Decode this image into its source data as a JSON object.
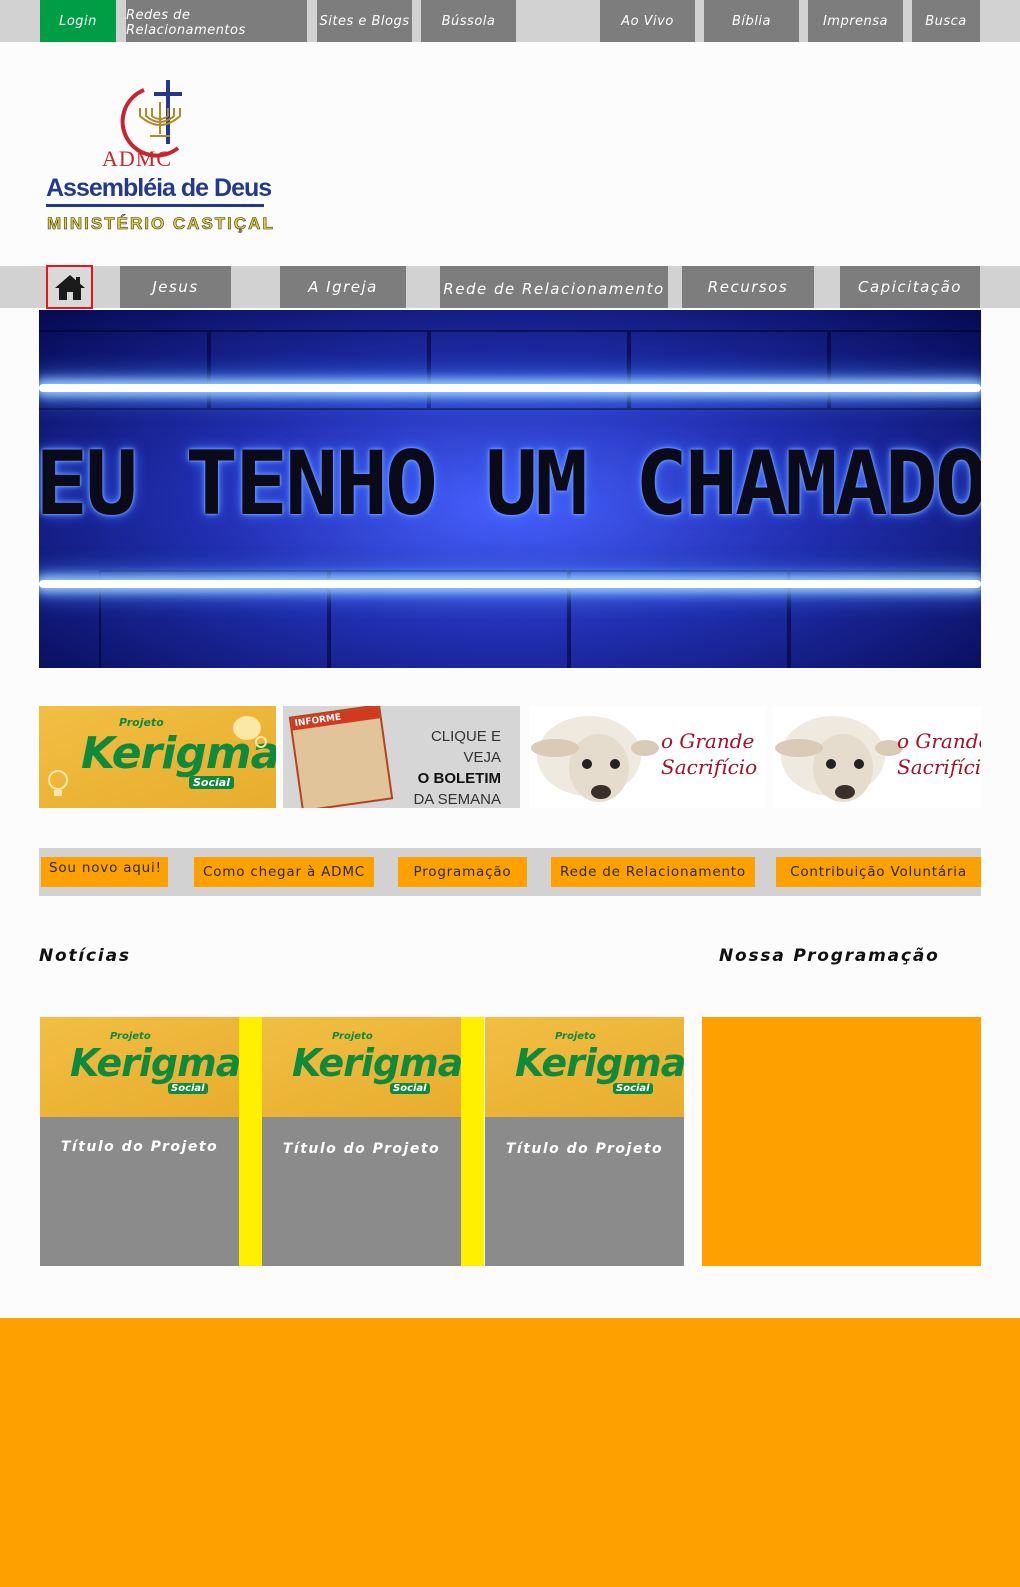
{
  "top_menu": {
    "login": "Login",
    "redes": "Redes de Relacionamentos",
    "sites": "Sites e Blogs",
    "bussola": "Bússola",
    "ao_vivo": "Ao Vivo",
    "biblia": "Bíblia",
    "imprensa": "Imprensa",
    "busca": "Busca"
  },
  "logo": {
    "acronym": "ADMC",
    "name": "Assembléia de Deus",
    "ministry": "MINISTÉRIO CASTIÇAL"
  },
  "main_nav": {
    "home_icon": "home-icon",
    "jesus": "Jesus",
    "igreja": "A Igreja",
    "rede": "Rede de Relacionamento",
    "recursos": "Recursos",
    "capacitacao": "Capicitação"
  },
  "banner": {
    "text": "EU TENHO UM CHAMADO"
  },
  "tiles": {
    "kerigma": {
      "projeto": "Projeto",
      "title": "Kerigma",
      "social": "Social"
    },
    "boletim": {
      "informe": "INFORME",
      "line1": "CLIQUE E VEJA",
      "line2": "O BOLETIM",
      "line3": "DA SEMANA"
    },
    "sacrificio": {
      "line1": "o Grande",
      "line2": "Sacrifício"
    }
  },
  "quick_links": {
    "novo": "Sou novo aqui!",
    "chegar": "Como chegar à ADMC",
    "programacao": "Programação",
    "rede": "Rede de Relacionamento",
    "contribuicao": "Contribuição Voluntária"
  },
  "sections": {
    "noticias": "Notícias",
    "nossa_programacao": "Nossa Programação"
  },
  "news_cards": [
    {
      "title": "Título do Projeto"
    },
    {
      "title": "Título do Projeto"
    },
    {
      "title": "Título do Projeto"
    }
  ],
  "colors": {
    "orange": "#fda000",
    "gray_button": "#7d7d7d",
    "login_green": "#009e44",
    "separator_yellow": "#fff000",
    "home_border": "#e8141c"
  }
}
